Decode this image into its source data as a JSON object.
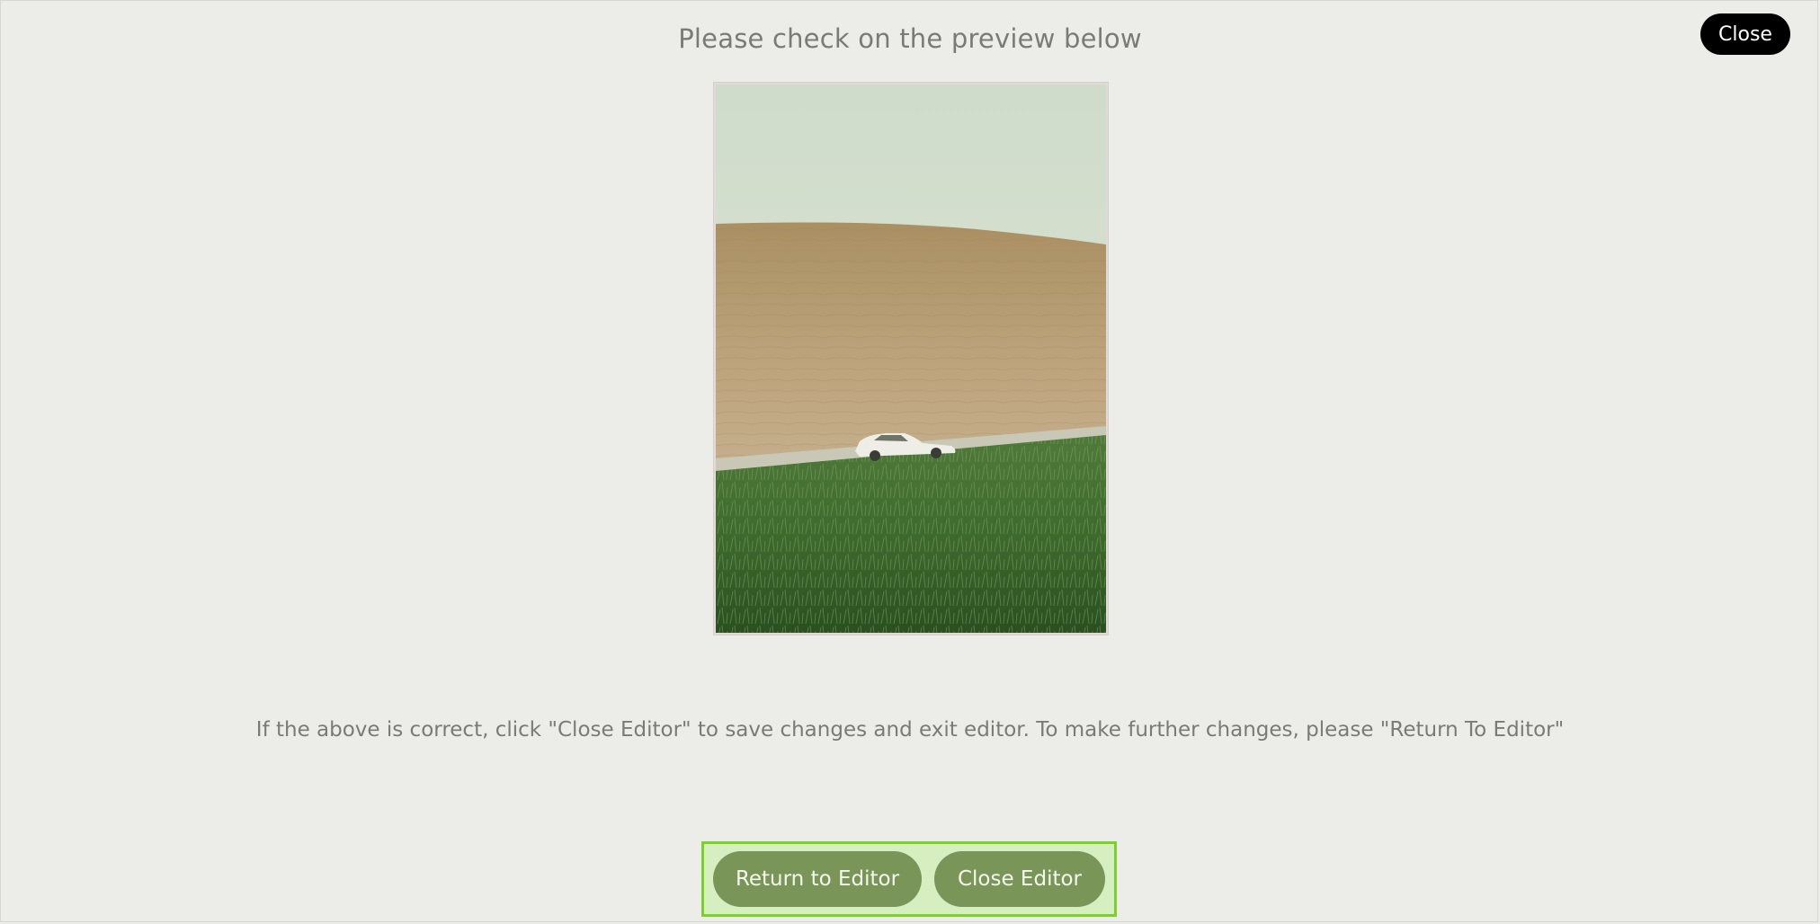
{
  "dialog": {
    "heading": "Please check on the preview below",
    "close_label": "Close",
    "instruction": "If the above is correct, click \"Close Editor\" to save changes and exit editor. To make further changes, please \"Return To Editor\""
  },
  "actions": {
    "return_label": "Return to Editor",
    "close_editor_label": "Close Editor"
  },
  "colors": {
    "background": "#ecece8",
    "close_button": "#000000",
    "action_button": "#7a9558",
    "highlight_fill": "#d6eec0",
    "highlight_border": "#7ad12a"
  }
}
